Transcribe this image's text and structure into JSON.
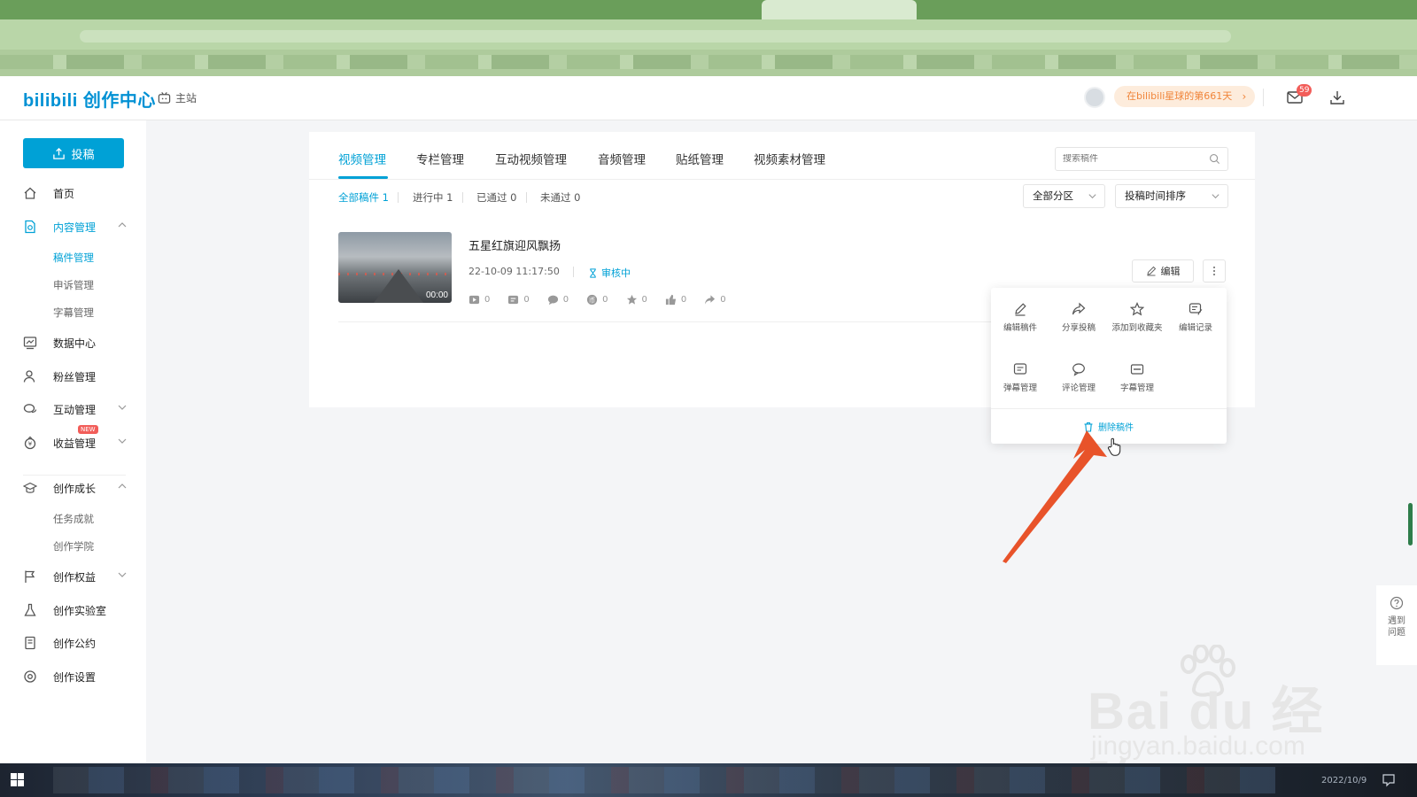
{
  "header": {
    "logo": "bilibili 创作中心",
    "home_link": "主站",
    "planet_days": "在bilibili星球的第661天",
    "mail_badge": "59"
  },
  "sidebar": {
    "upload_label": "投稿",
    "items": {
      "home": "首页",
      "content": "内容管理",
      "content_sub": [
        "稿件管理",
        "申诉管理",
        "字幕管理"
      ],
      "data": "数据中心",
      "fans": "粉丝管理",
      "interaction": "互动管理",
      "income": "收益管理",
      "income_tag": "NEW",
      "growth": "创作成长",
      "growth_sub": [
        "任务成就",
        "创作学院"
      ],
      "rights": "创作权益",
      "lab": "创作实验室",
      "convention": "创作公约",
      "settings": "创作设置"
    }
  },
  "main": {
    "tabs": [
      "视频管理",
      "专栏管理",
      "互动视频管理",
      "音频管理",
      "贴纸管理",
      "视频素材管理"
    ],
    "search_placeholder": "搜索稿件",
    "filters": [
      "全部稿件 1",
      "进行中 1",
      "已通过 0",
      "未通过 0"
    ],
    "select_zone": "全部分区",
    "select_sort": "投稿时间排序",
    "video": {
      "title": "五星红旗迎风飘扬",
      "date": "22-10-09 11:17:50",
      "status": "审核中",
      "duration": "00:00",
      "stats": [
        "0",
        "0",
        "0",
        "0",
        "0",
        "0",
        "0"
      ],
      "edit_label": "编辑"
    }
  },
  "popup": {
    "row1": [
      "编辑稿件",
      "分享投稿",
      "添加到收藏夹",
      "编辑记录"
    ],
    "row2": [
      "弹幕管理",
      "评论管理",
      "字幕管理"
    ],
    "delete": "删除稿件"
  },
  "help": {
    "line1": "遇到",
    "line2": "问题"
  },
  "watermark": {
    "main": "Bai du 经验",
    "sub": "jingyan.baidu.com"
  },
  "taskbar": {
    "clock": "2022/10/9"
  },
  "colors": {
    "accent": "#00a1d6",
    "badge": "#f25d59",
    "arrow": "#e8532a",
    "planet_text": "#f0853a"
  }
}
